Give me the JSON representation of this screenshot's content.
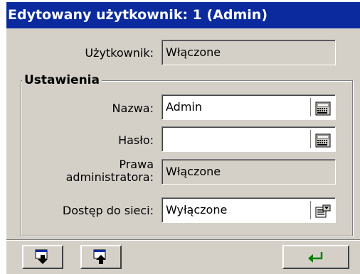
{
  "window": {
    "title": "Edytowany użytkownik: 1 (Admin)"
  },
  "user": {
    "label": "Użytkownik:",
    "value": "Włączone"
  },
  "settings": {
    "title": "Ustawienia",
    "name": {
      "label": "Nazwa:",
      "value": "Admin",
      "icon": "keyboard-icon"
    },
    "password": {
      "label": "Hasło:",
      "value": "",
      "icon": "keyboard-icon"
    },
    "admin_rights": {
      "label_line1": "Prawa",
      "label_line2": "administratora:",
      "value": "Włączone"
    },
    "network_access": {
      "label": "Dostęp do sieci:",
      "value": "Wyłączone",
      "icon": "dropdown-list-icon"
    }
  },
  "toolbar": {
    "buttons": [
      {
        "name": "move-down-button",
        "icon": "window-down-arrow-icon"
      },
      {
        "name": "move-up-button",
        "icon": "window-up-arrow-icon"
      },
      {
        "name": "enter-button",
        "icon": "enter-arrow-icon",
        "color": "#008000"
      }
    ]
  },
  "colors": {
    "title_bar": "#0a2a9e",
    "title_text": "#ffffff",
    "window_bg": "#d4d0c8"
  }
}
